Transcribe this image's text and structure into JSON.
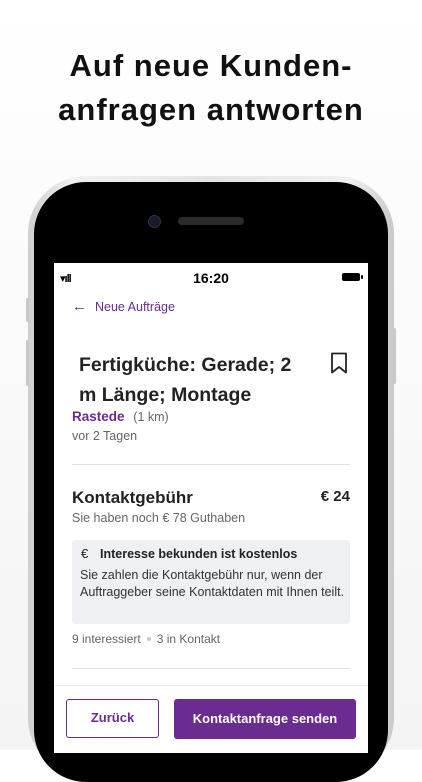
{
  "headline": {
    "line1": "Auf neue Kunden-",
    "line2": "anfragen antworten"
  },
  "status_bar": {
    "time": "16:20",
    "signal_glyph": "▾ıll"
  },
  "nav": {
    "back_label": "Neue Aufträge",
    "back_icon": "arrow-left-icon"
  },
  "job": {
    "title": "Fertigküche: Gerade; 2 m Länge; Montage",
    "city": "Rastede",
    "distance": "(1 km)",
    "posted": "vor 2 Tagen"
  },
  "fee": {
    "title": "Kontaktgebühr",
    "amount": "€ 24",
    "balance": "Sie haben noch € 78 Guthaben"
  },
  "info": {
    "icon": "€",
    "title": "Interesse bekunden ist kostenlos",
    "text": "Sie zahlen die Kontaktgebühr nur, wenn der Auftraggeber seine Kontaktdaten mit Ihnen teilt."
  },
  "stats": {
    "interested": "9 interessiert",
    "in_contact": "3 in Kontakt"
  },
  "actions": {
    "back": "Zurück",
    "send": "Kontaktanfrage senden"
  },
  "colors": {
    "accent": "#6a2c91",
    "info_bg": "#eef0f4"
  }
}
